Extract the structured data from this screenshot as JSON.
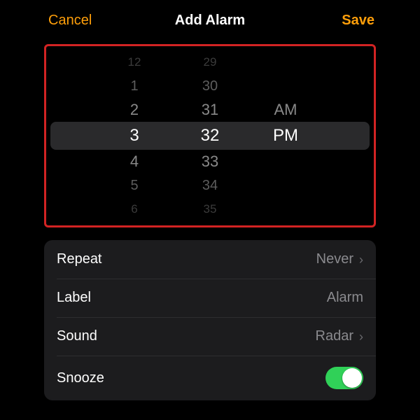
{
  "header": {
    "cancel": "Cancel",
    "title": "Add Alarm",
    "save": "Save"
  },
  "picker": {
    "hour": {
      "minus4": "12",
      "minus3": "12",
      "minus2": "1",
      "minus1": "2",
      "selected": "3",
      "plus1": "4",
      "plus2": "5",
      "plus3": "6"
    },
    "minute": {
      "minus4": "29",
      "minus3": "29",
      "minus2": "30",
      "minus1": "31",
      "selected": "32",
      "plus1": "33",
      "plus2": "34",
      "plus3": "35"
    },
    "ampm": {
      "other": "AM",
      "selected": "PM"
    }
  },
  "settings": {
    "repeat": {
      "label": "Repeat",
      "value": "Never"
    },
    "label": {
      "label": "Label",
      "value": "Alarm"
    },
    "sound": {
      "label": "Sound",
      "value": "Radar"
    },
    "snooze": {
      "label": "Snooze",
      "on": true
    }
  }
}
